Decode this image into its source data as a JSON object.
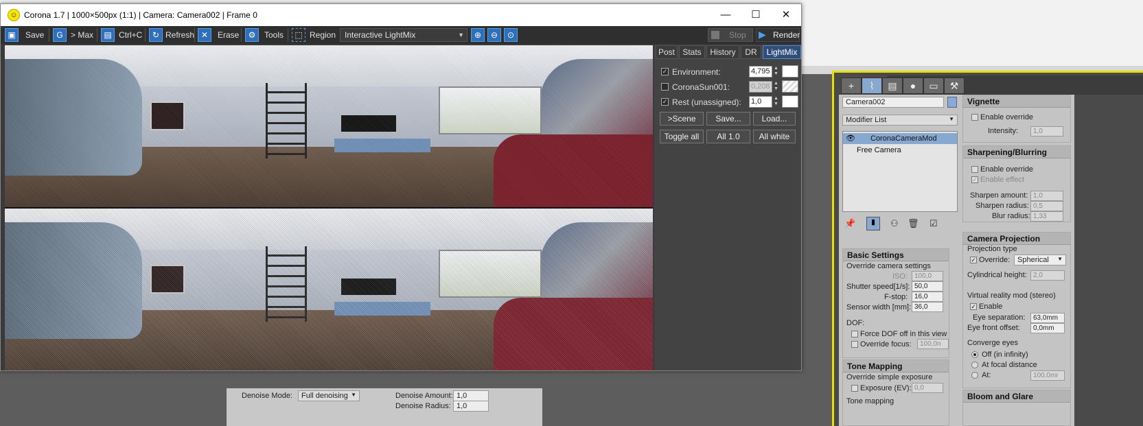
{
  "window": {
    "title": "Corona 1.7 | 1000×500px (1:1) | Camera: Camera002 | Frame 0"
  },
  "toolbar": {
    "save": "Save",
    "max": "> Max",
    "copy": "Ctrl+C",
    "refresh": "Refresh",
    "erase": "Erase",
    "tools": "Tools",
    "region": "Region",
    "lightmix_mode": "Interactive LightMix",
    "stop": "Stop",
    "render": "Render"
  },
  "side": {
    "tabs": [
      "Post",
      "Stats",
      "History",
      "DR",
      "LightMix"
    ],
    "active_tab": "LightMix",
    "lights": [
      {
        "label": "Environment:",
        "value": "4,795",
        "checked": true,
        "enabled": true
      },
      {
        "label": "CoronaSun001:",
        "value": "0,208",
        "checked": false,
        "enabled": false
      },
      {
        "label": "Rest (unassigned):",
        "value": "1,0",
        "checked": true,
        "enabled": true
      }
    ],
    "buttons_row1": [
      ">Scene",
      "Save...",
      "Load..."
    ],
    "buttons_row2": [
      "Toggle all",
      "All 1.0",
      "All white"
    ]
  },
  "denoise": {
    "mode_label": "Denoise Mode:",
    "mode_value": "Full denoising",
    "amount_label": "Denoise Amount:",
    "amount_value": "1,0",
    "radius_label": "Denoise Radius:",
    "radius_value": "1,0"
  },
  "command": {
    "object_name": "Camera002",
    "modifier_list": "Modifier List",
    "stack": [
      "CoronaCameraMod",
      "Free Camera"
    ],
    "basic": {
      "title": "Basic Settings",
      "override": "Override camera settings",
      "iso_label": "ISO:",
      "iso": "100,0",
      "shutter_label": "Shutter speed[1/s]:",
      "shutter": "50,0",
      "fstop_label": "F-stop:",
      "fstop": "16,0",
      "sensor_label": "Sensor width [mm]:",
      "sensor": "36,0",
      "dof_label": "DOF:",
      "force_dof": "Force DOF off in this view",
      "override_focus": "Override focus:",
      "focus": "100,0n"
    },
    "tone": {
      "title": "Tone Mapping",
      "override": "Override simple exposure",
      "exposure_label": "Exposure (EV):",
      "exposure": "0,0",
      "more": "Tone mapping"
    },
    "vignette": {
      "title": "Vignette",
      "enable": "Enable override",
      "intensity_label": "Intensity:",
      "intensity": "1,0"
    },
    "sharpen": {
      "title": "Sharpening/Blurring",
      "enable": "Enable override",
      "effect": "Enable effect",
      "amount_label": "Sharpen amount:",
      "amount": "1,0",
      "radius_label": "Sharpen radius:",
      "radius": "0,5",
      "blur_label": "Blur radius:",
      "blur": "1,33"
    },
    "projection": {
      "title": "Camera Projection",
      "type_label": "Projection type",
      "override": "Override:",
      "override_value": "Spherical",
      "cyl_label": "Cylindrical height:",
      "cyl": "2,0",
      "vr_label": "Virtual reality mod (stereo)",
      "vr_enable": "Enable",
      "eye_sep_label": "Eye separation:",
      "eye_sep": "63,0mm",
      "eye_front_label": "Eye front offset:",
      "eye_front": "0,0mm",
      "converge_label": "Converge eyes",
      "conv_off": "Off (in infinity)",
      "conv_focal": "At focal distance",
      "conv_at": "At:",
      "conv_at_value": "100,0mr"
    },
    "bloom": {
      "title": "Bloom and Glare"
    }
  },
  "colors": {
    "accent": "#2e6fb8",
    "active_tab": "#2f4f7a",
    "selection": "#87a9cf",
    "frame": "#e8e000"
  }
}
